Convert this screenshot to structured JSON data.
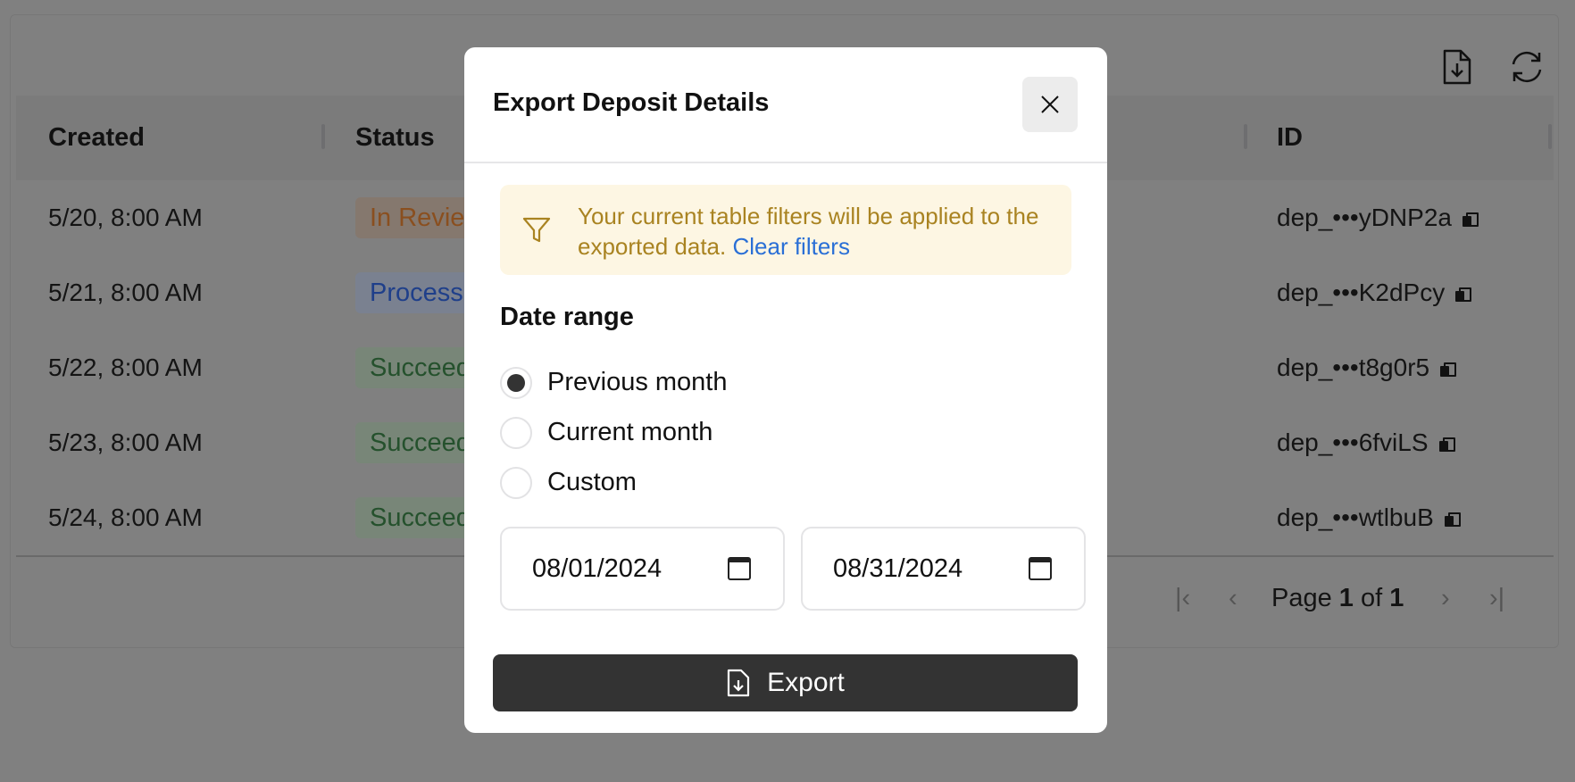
{
  "toolbar": {
    "download_icon": "file-download-icon",
    "refresh_icon": "refresh-icon"
  },
  "table": {
    "columns": [
      "Created",
      "Status",
      "ID"
    ],
    "rows": [
      {
        "created": "5/20, 8:00 AM",
        "status": "In Review",
        "id": "dep_•••yDNP2a"
      },
      {
        "created": "5/21, 8:00 AM",
        "status": "Processing",
        "id": "dep_•••K2dPcy"
      },
      {
        "created": "5/22, 8:00 AM",
        "status": "Succeeded",
        "id": "dep_•••t8g0r5"
      },
      {
        "created": "5/23, 8:00 AM",
        "status": "Succeeded",
        "id": "dep_•••6fviLS"
      },
      {
        "created": "5/24, 8:00 AM",
        "status": "Succeeded",
        "id": "dep_•••wtlbuB"
      }
    ]
  },
  "pagination": {
    "page_word": "Page",
    "current": "1",
    "of_word": "of",
    "total": "1"
  },
  "modal": {
    "title": "Export Deposit Details",
    "alert_text": "Your current table filters will be applied to the exported data.",
    "alert_link": "Clear filters",
    "date_range_label": "Date range",
    "options": [
      "Previous month",
      "Current month",
      "Custom"
    ],
    "selected_option": "Previous month",
    "start_date": "08/01/2024",
    "end_date": "08/31/2024",
    "export_label": "Export"
  },
  "colors": {
    "accent": "#333333",
    "alert_bg": "#fdf6e3",
    "alert_text": "#a98321",
    "link": "#2a6fd6"
  }
}
